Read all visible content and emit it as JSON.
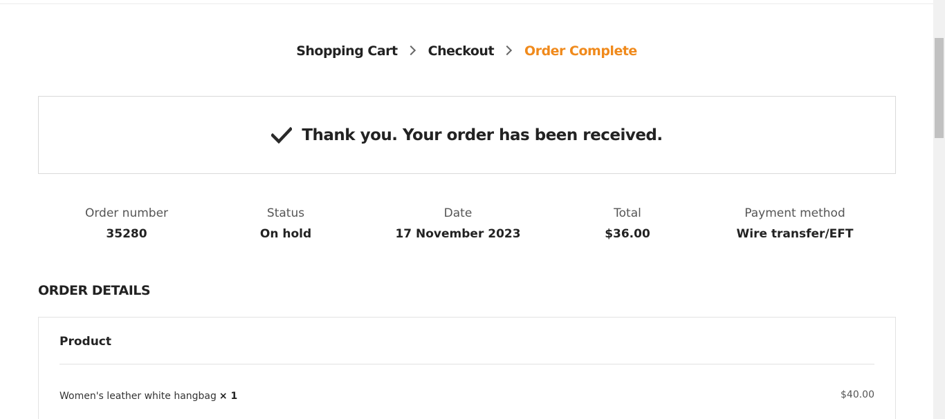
{
  "breadcrumb": {
    "steps": [
      "Shopping Cart",
      "Checkout",
      "Order Complete"
    ],
    "current_color": "#f08a1c"
  },
  "notice": {
    "icon": "check-icon",
    "text": "Thank you. Your order has been received."
  },
  "overview": {
    "order_number": {
      "label": "Order number",
      "value": "35280"
    },
    "status": {
      "label": "Status",
      "value": "On hold"
    },
    "date": {
      "label": "Date",
      "value": "17 November 2023"
    },
    "total": {
      "label": "Total",
      "value": "$36.00"
    },
    "payment_method": {
      "label": "Payment method",
      "value": "Wire transfer/EFT"
    }
  },
  "order_details": {
    "title": "ORDER DETAILS",
    "column_header": "Product",
    "items": [
      {
        "name": "Women's leather white hangbag",
        "qty": "× 1",
        "price": "$40.00"
      }
    ]
  }
}
